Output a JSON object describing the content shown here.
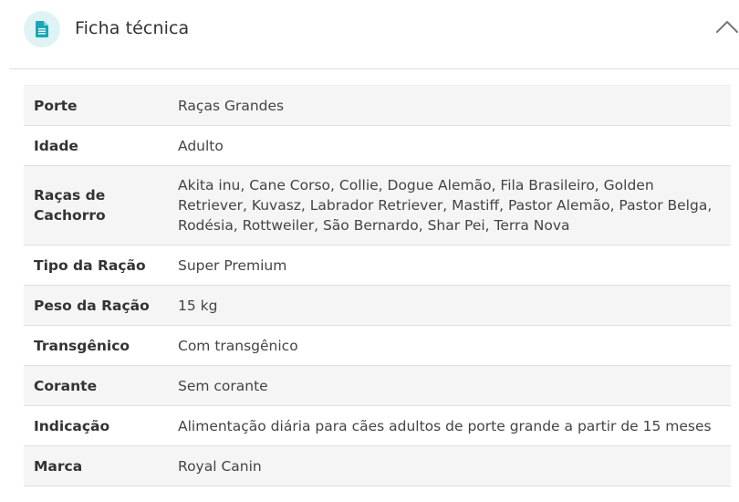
{
  "section": {
    "title": "Ficha técnica",
    "icon": "document-icon",
    "toggle_icon": "chevron-up-icon",
    "accent_color": "#dff3f5",
    "icon_color": "#1aa7b5"
  },
  "specs": {
    "rows": [
      {
        "label": "Porte",
        "value": "Raças Grandes"
      },
      {
        "label": "Idade",
        "value": "Adulto"
      },
      {
        "label": "Raças de Cachorro",
        "value": "Akita inu, Cane Corso, Collie, Dogue Alemão, Fila Brasileiro, Golden Retriever, Kuvasz, Labrador Retriever, Mastiff, Pastor Alemão, Pastor Belga, Rodésia, Rottweiler, São Bernardo, Shar Pei, Terra Nova"
      },
      {
        "label": "Tipo da Ração",
        "value": "Super Premium"
      },
      {
        "label": "Peso da Ração",
        "value": "15 kg"
      },
      {
        "label": "Transgênico",
        "value": "Com transgênico"
      },
      {
        "label": "Corante",
        "value": "Sem corante"
      },
      {
        "label": "Indicação",
        "value": "Alimentação diária para cães adultos de porte grande a partir de 15 meses"
      },
      {
        "label": "Marca",
        "value": "Royal Canin"
      }
    ]
  }
}
